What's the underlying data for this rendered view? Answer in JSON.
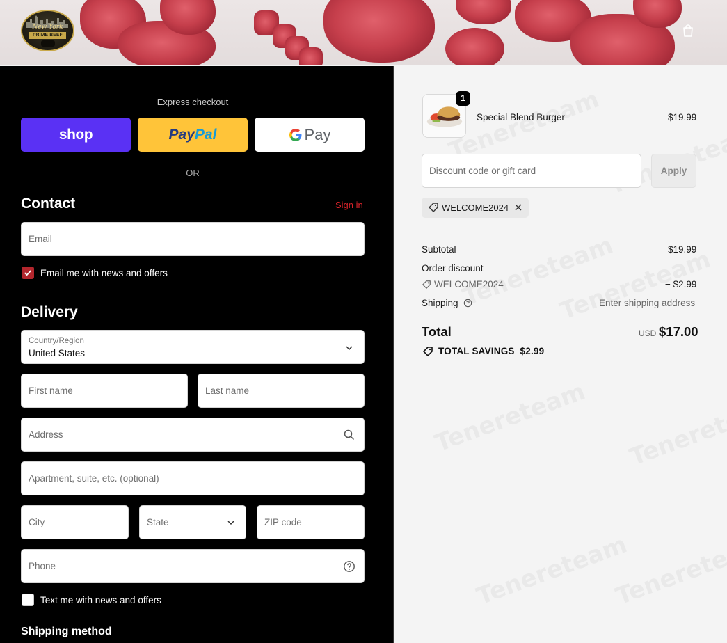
{
  "header": {
    "logo": {
      "script": "New York",
      "band": "PRIME BEEF"
    },
    "cart_icon": "shopping-bag-icon"
  },
  "express": {
    "title": "Express checkout",
    "shop_label": "shop",
    "paypal_label_1": "Pay",
    "paypal_label_2": "Pal",
    "gpay_label": "Pay",
    "or_label": "OR"
  },
  "contact": {
    "heading": "Contact",
    "signin": "Sign in",
    "email_placeholder": "Email",
    "news_label": "Email me with news and offers",
    "news_checked": true
  },
  "delivery": {
    "heading": "Delivery",
    "country_label": "Country/Region",
    "country_value": "United States",
    "first_name": "First name",
    "last_name": "Last name",
    "address": "Address",
    "apartment": "Apartment, suite, etc. (optional)",
    "city": "City",
    "state": "State",
    "zip": "ZIP code",
    "phone": "Phone",
    "sms_label": "Text me with news and offers",
    "sms_checked": false
  },
  "shipping_method": {
    "heading": "Shipping method"
  },
  "summary": {
    "item": {
      "name": "Special Blend Burger",
      "price": "$19.99",
      "qty": "1"
    },
    "discount_placeholder": "Discount code or gift card",
    "apply_label": "Apply",
    "applied_code": "WELCOME2024",
    "subtotal_label": "Subtotal",
    "subtotal_value": "$19.99",
    "order_discount_label": "Order discount",
    "discount_code": "WELCOME2024",
    "discount_value": "− $2.99",
    "shipping_label": "Shipping",
    "shipping_value": "Enter shipping address",
    "total_label": "Total",
    "currency": "USD",
    "total_value": "$17.00",
    "savings_label": "TOTAL SAVINGS",
    "savings_value": "$2.99"
  },
  "watermark": "Tenereteam",
  "colors": {
    "accent": "#d8232a",
    "checkbox": "#b3262d",
    "shop": "#5a31f4",
    "paypal": "#ffc439"
  }
}
